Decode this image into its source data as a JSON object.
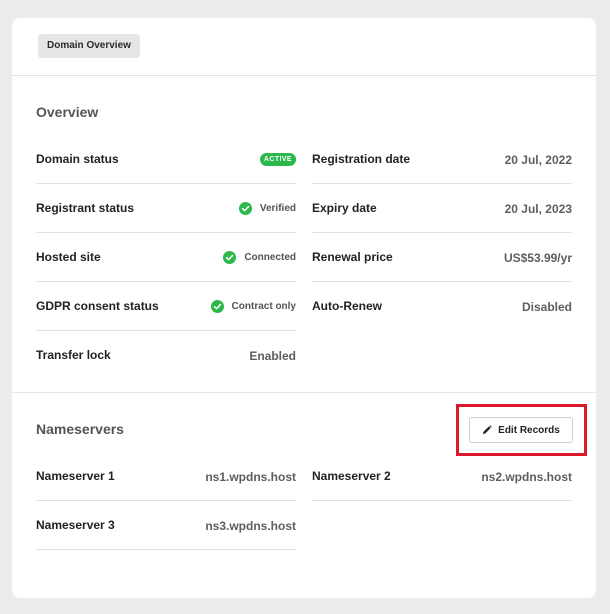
{
  "header": {
    "tab_label": "Domain Overview"
  },
  "overview": {
    "title": "Overview",
    "left": [
      {
        "label": "Domain status",
        "value": "ACTIVE",
        "kind": "badge"
      },
      {
        "label": "Registrant status",
        "value": "Verified",
        "kind": "check"
      },
      {
        "label": "Hosted site",
        "value": "Connected",
        "kind": "check"
      },
      {
        "label": "GDPR consent status",
        "value": "Contract only",
        "kind": "check"
      },
      {
        "label": "Transfer lock",
        "value": "Enabled",
        "kind": "text"
      }
    ],
    "right": [
      {
        "label": "Registration date",
        "value": "20 Jul, 2022"
      },
      {
        "label": "Expiry date",
        "value": "20 Jul, 2023"
      },
      {
        "label": "Renewal price",
        "value": "US$53.99/yr"
      },
      {
        "label": "Auto-Renew",
        "value": "Disabled"
      }
    ]
  },
  "nameservers": {
    "title": "Nameservers",
    "edit_button_label": "Edit Records",
    "left": [
      {
        "label": "Nameserver 1",
        "value": "ns1.wpdns.host"
      },
      {
        "label": "Nameserver 3",
        "value": "ns3.wpdns.host"
      }
    ],
    "right": [
      {
        "label": "Nameserver 2",
        "value": "ns2.wpdns.host"
      }
    ]
  },
  "icons": {
    "check": "check-circle-icon",
    "pencil": "pencil-icon"
  },
  "colors": {
    "active_badge": "#2db84c",
    "check_circle": "#2db84c",
    "highlight": "#e0192a"
  }
}
